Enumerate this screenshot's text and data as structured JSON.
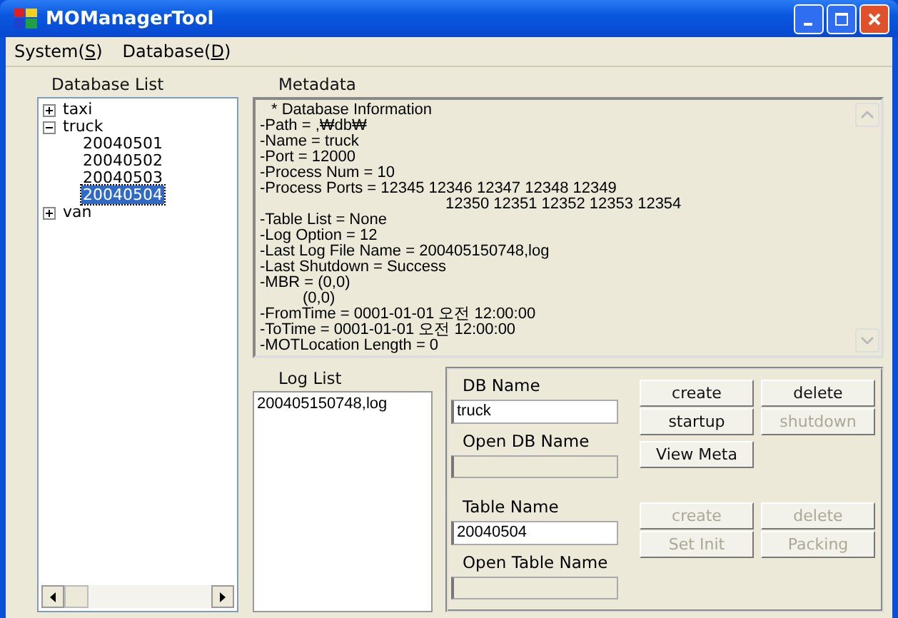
{
  "window": {
    "title": "MOManagerTool"
  },
  "menu": [
    {
      "label": "System(",
      "key": "S",
      "end": ")"
    },
    {
      "label": "Database(",
      "key": "D",
      "end": ")"
    }
  ],
  "database_list": {
    "label": "Database List",
    "tree": [
      {
        "label": "taxi",
        "expanded": false,
        "selected": false
      },
      {
        "label": "truck",
        "expanded": true,
        "selected": false,
        "children": [
          {
            "label": "20040501",
            "selected": false
          },
          {
            "label": "20040502",
            "selected": false
          },
          {
            "label": "20040503",
            "selected": false
          },
          {
            "label": "20040504",
            "selected": true
          }
        ]
      },
      {
        "label": "van",
        "expanded": false,
        "selected": false
      }
    ]
  },
  "metadata": {
    "label": "Metadata",
    "lines": [
      {
        "kind": "header",
        "text": "* Database Information"
      },
      {
        "kind": "item",
        "text": "-Path = ,₩db₩"
      },
      {
        "kind": "item",
        "text": "-Name = truck"
      },
      {
        "kind": "item",
        "text": "-Port = 12000"
      },
      {
        "kind": "item",
        "text": "-Process Num = 10"
      },
      {
        "kind": "item",
        "text": "-Process Ports = 12345 12346 12347 12348 12349"
      },
      {
        "kind": "wrap-long",
        "text": "12350 12351 12352 12353 12354"
      },
      {
        "kind": "item",
        "text": "-Table List = None"
      },
      {
        "kind": "item",
        "text": "-Log Option = 12"
      },
      {
        "kind": "item",
        "text": "-Last Log File Name = 200405150748,log"
      },
      {
        "kind": "item",
        "text": "-Last Shutdown = Success"
      },
      {
        "kind": "item",
        "text": "-MBR = (0,0)"
      },
      {
        "kind": "wrap-short",
        "text": "(0,0)"
      },
      {
        "kind": "item",
        "text": "-FromTime = 0001-01-01 오전 12:00:00"
      },
      {
        "kind": "item",
        "text": "-ToTime = 0001-01-01 오전 12:00:00"
      },
      {
        "kind": "item",
        "text": "-MOTLocation Length = 0"
      }
    ]
  },
  "log_list": {
    "label": "Log List",
    "items": [
      "200405150748,log"
    ]
  },
  "db": {
    "db_name_label": "DB Name",
    "db_name_value": "truck",
    "open_db_name_label": "Open DB Name",
    "buttons": [
      {
        "label": "create",
        "disabled": false
      },
      {
        "label": "delete",
        "disabled": false
      },
      {
        "label": "startup",
        "disabled": false
      },
      {
        "label": "shutdown",
        "disabled": true
      }
    ],
    "view_meta": {
      "label": "View Meta",
      "disabled": false
    }
  },
  "table": {
    "table_name_label": "Table Name",
    "table_name_value": "20040504",
    "open_table_name_label": "Open Table Name",
    "buttons": [
      {
        "label": "create",
        "disabled": true
      },
      {
        "label": "delete",
        "disabled": true
      },
      {
        "label": "Set Init",
        "disabled": true
      },
      {
        "label": "Packing",
        "disabled": true
      }
    ]
  }
}
